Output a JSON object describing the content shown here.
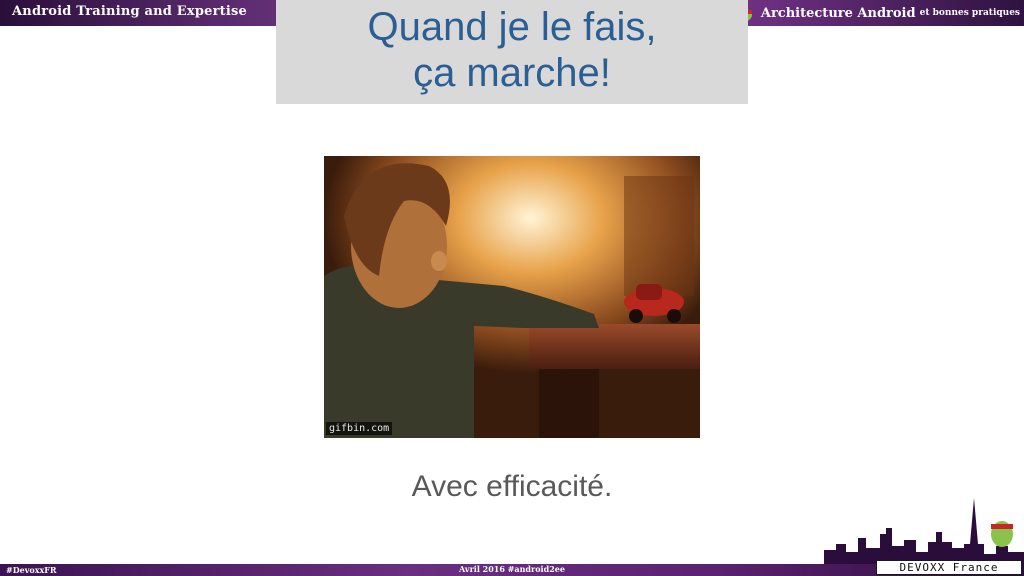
{
  "header": {
    "left_title": "Android Training and Expertise",
    "right_title": "Architecture Android",
    "right_subtitle": "et bonnes pratiques"
  },
  "slide": {
    "title_line1": "Quand je le fais,",
    "title_line2": "ça marche!",
    "image_watermark": "gifbin.com",
    "caption": "Avec efficacité."
  },
  "footer": {
    "hashtag": "#DevoxxFR",
    "center": "Avril 2016 #android2ee",
    "conference_logo": "DEVOXX France"
  },
  "colors": {
    "title": "#2b5f93",
    "title_box": "#d9d9d9",
    "caption": "#595959",
    "bar_purple": "#6a2f80"
  }
}
